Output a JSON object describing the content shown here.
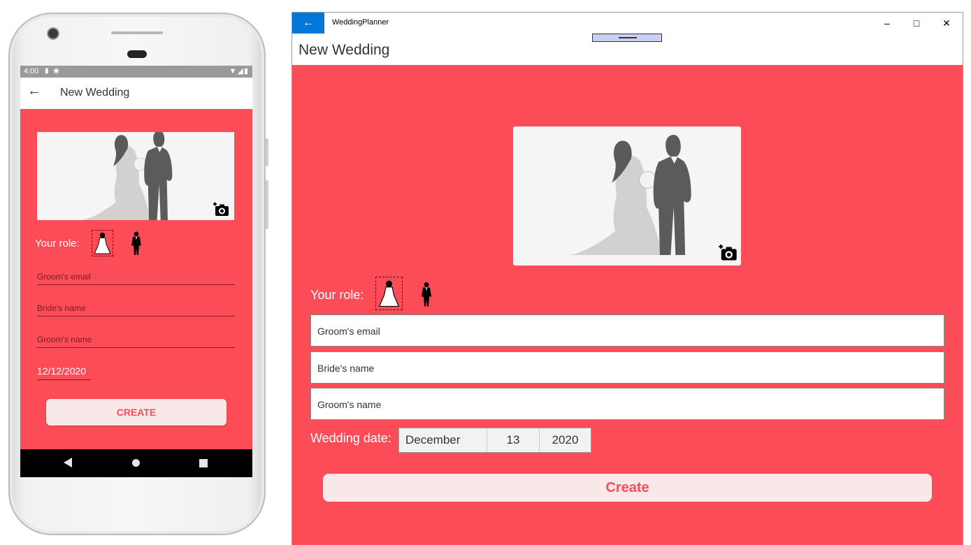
{
  "colors": {
    "accent": "#fb4c57",
    "button_bg": "#f8e8e8",
    "titlebar_back": "#0078d7"
  },
  "android": {
    "status": {
      "time": "4:00"
    },
    "appbar": {
      "back_icon": "arrow-left-icon",
      "title": "New Wedding"
    },
    "role_label": "Your role:",
    "fields": [
      {
        "placeholder": "Groom's email"
      },
      {
        "placeholder": "Bride's name"
      },
      {
        "placeholder": "Groom's name"
      }
    ],
    "date": "12/12/2020",
    "create_label": "CREATE"
  },
  "windows": {
    "app_title": "WeddingPlanner",
    "page_title": "New Wedding",
    "controls": {
      "minimize": "–",
      "maximize": "□",
      "close": "✕"
    },
    "role_label": "Your role:",
    "fields": [
      {
        "placeholder": "Groom's email"
      },
      {
        "placeholder": "Bride's name"
      },
      {
        "placeholder": "Groom's name"
      }
    ],
    "date_label": "Wedding date:",
    "date": {
      "month": "December",
      "day": "13",
      "year": "2020"
    },
    "create_label": "Create"
  }
}
